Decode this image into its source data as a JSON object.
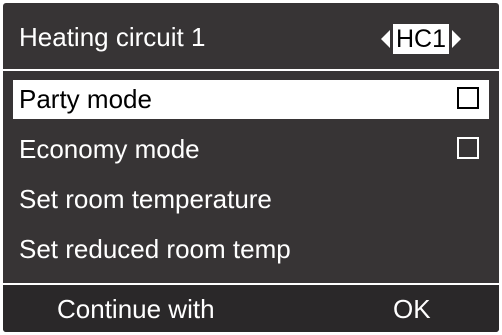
{
  "header": {
    "title": "Heating circuit 1",
    "circuit_selector": "HC1"
  },
  "menu": {
    "items": [
      {
        "label": "Party mode",
        "checkbox": true,
        "checked": false,
        "selected": true
      },
      {
        "label": "Economy mode",
        "checkbox": true,
        "checked": false,
        "selected": false
      },
      {
        "label": "Set room temperature",
        "checkbox": false,
        "selected": false
      },
      {
        "label": "Set reduced room temp",
        "checkbox": false,
        "selected": false
      }
    ]
  },
  "footer": {
    "action_label": "Continue with",
    "confirm_label": "OK"
  },
  "colors": {
    "background": "#373435",
    "foreground": "#ffffff",
    "highlight": "#ffffff",
    "highlight_text": "#000000"
  }
}
